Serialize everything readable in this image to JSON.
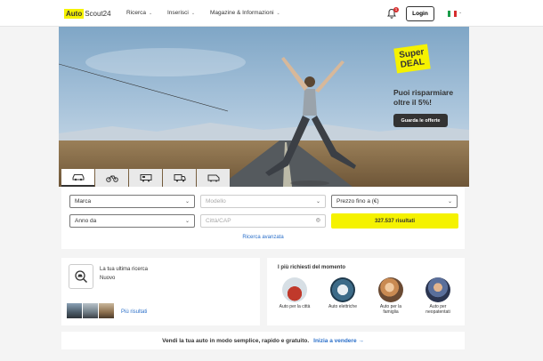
{
  "header": {
    "logo_auto": "Auto",
    "logo_scout": "Scout24",
    "nav": [
      "Ricerca",
      "Inserisci",
      "Magazine & Informazioni"
    ],
    "notification_count": "1",
    "login_label": "Login",
    "language": "it"
  },
  "hero": {
    "deal_line1": "Super",
    "deal_line2": "DEAL",
    "promo_text": "Puoi risparmiare oltre il 5%!",
    "promo_button": "Guarda le offerte"
  },
  "vehicle_tabs": [
    {
      "icon": "car-icon",
      "active": true
    },
    {
      "icon": "motorcycle-icon",
      "active": false
    },
    {
      "icon": "camper-icon",
      "active": false
    },
    {
      "icon": "truck-icon",
      "active": false
    },
    {
      "icon": "van-icon",
      "active": false
    }
  ],
  "search": {
    "make": "Marca",
    "model": "Modello",
    "price": "Prezzo fino a (€)",
    "year": "Anno da",
    "city_placeholder": "Città/CAP",
    "results_button": "327.537 risultati",
    "advanced": "Ricerca avanzata"
  },
  "last_search": {
    "title": "La tua ultima ricerca",
    "subtitle": "Nuovo",
    "more": "Più risultati"
  },
  "popular": {
    "title": "I più richiesti del momento",
    "items": [
      {
        "label": "Auto per la città"
      },
      {
        "label": "Auto elettriche"
      },
      {
        "label": "Auto per la famiglia"
      },
      {
        "label": "Auto per neopatentati"
      }
    ]
  },
  "sell": {
    "text": "Vendi la tua auto in modo semplice, rapido e gratuito.",
    "link": "Inizia a vendere"
  },
  "colors": {
    "brand_yellow": "#f5f200",
    "link_blue": "#2a6fc9",
    "dark": "#333333"
  }
}
